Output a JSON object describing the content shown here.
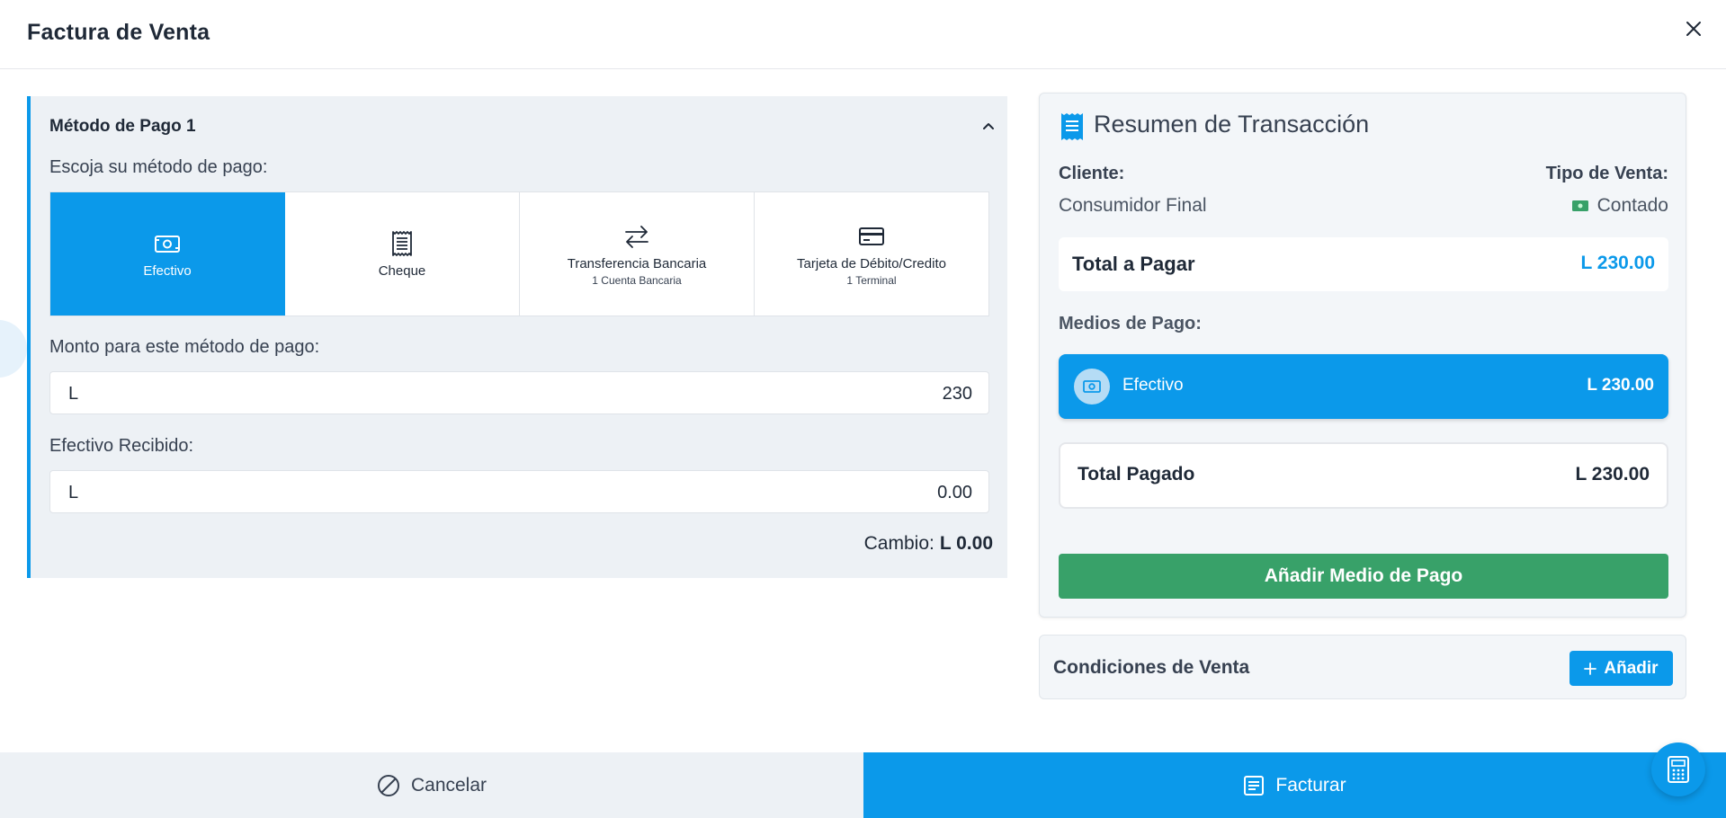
{
  "header": {
    "title": "Factura de Venta"
  },
  "payment_panel": {
    "title": "Método de Pago 1",
    "choose_label": "Escoja su método de pago:",
    "methods": [
      {
        "name": "Efectivo",
        "sub": "",
        "icon": "cash-icon",
        "active": true
      },
      {
        "name": "Cheque",
        "sub": "",
        "icon": "receipt-icon",
        "active": false
      },
      {
        "name": "Transferencia Bancaria",
        "sub": "1 Cuenta Bancaria",
        "icon": "transfer-arrows-icon",
        "active": false
      },
      {
        "name": "Tarjeta de Débito/Credito",
        "sub": "1 Terminal",
        "icon": "credit-card-icon",
        "active": false
      }
    ],
    "amount_label": "Monto para este método de pago:",
    "amount_prefix": "L",
    "amount_value": "230",
    "received_label": "Efectivo Recibido:",
    "received_prefix": "L",
    "received_value": "0.00",
    "change_label": "Cambio:",
    "change_value": "L 0.00"
  },
  "summary": {
    "title": "Resumen de Transacción",
    "client_label": "Cliente:",
    "client_value": "Consumidor Final",
    "sale_type_label": "Tipo de Venta:",
    "sale_type_value": "Contado",
    "total_label": "Total a Pagar",
    "total_value": "L 230.00",
    "payment_methods_label": "Medios de Pago:",
    "payment_item": {
      "label": "Efectivo",
      "value": "L 230.00"
    },
    "paid_label": "Total Pagado",
    "paid_value": "L 230.00",
    "add_method_label": "Añadir Medio de Pago"
  },
  "conditions": {
    "label": "Condiciones de Venta",
    "add_label": "Añadir"
  },
  "footer": {
    "cancel_label": "Cancelar",
    "invoice_label": "Facturar"
  },
  "colors": {
    "accent": "#0b99ea",
    "success": "#38a169",
    "panel_bg": "#edf1f5"
  }
}
